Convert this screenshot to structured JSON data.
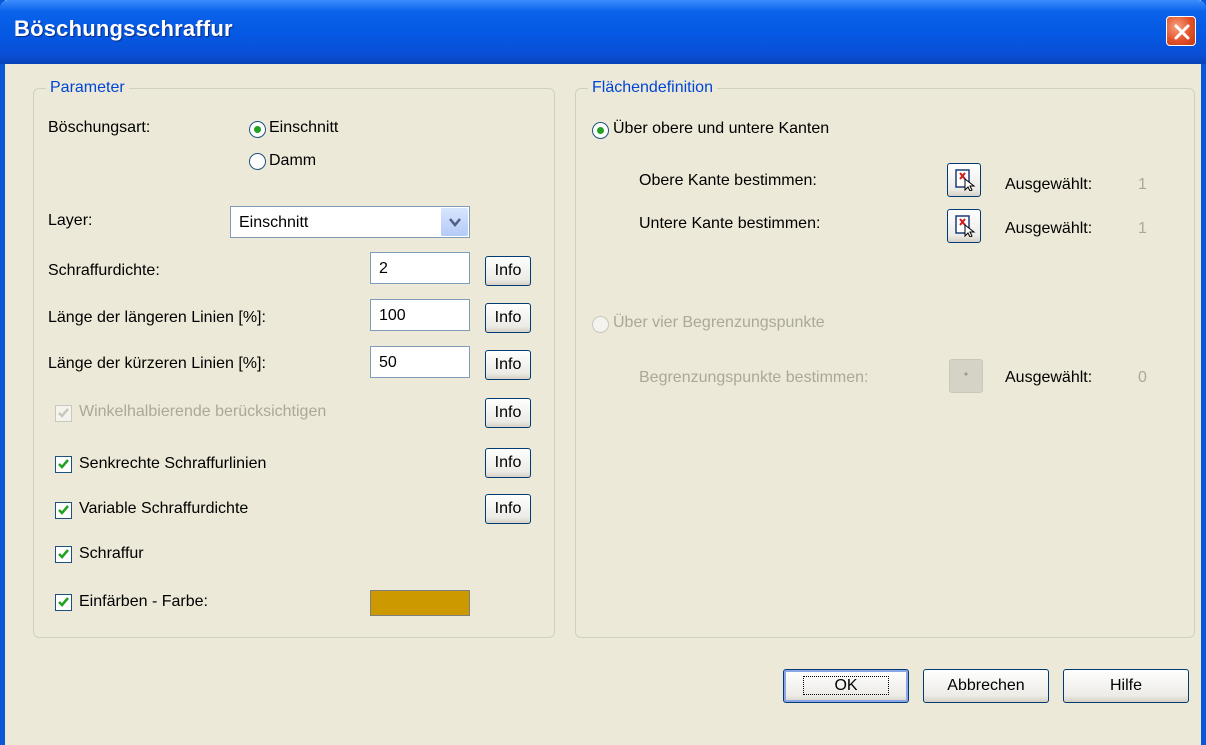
{
  "window": {
    "title": "Böschungsschraffur"
  },
  "parameter": {
    "legend": "Parameter",
    "boeschungsart_label": "Böschungsart:",
    "radio_einschnitt": "Einschnitt",
    "radio_damm": "Damm",
    "layer_label": "Layer:",
    "layer_value": "Einschnitt",
    "dichte_label": "Schraffurdichte:",
    "dichte_value": "2",
    "laengere_label": "Länge der längeren Linien [%]:",
    "laengere_value": "100",
    "kuerzere_label": "Länge der kürzeren Linien [%]:",
    "kuerzere_value": "50",
    "winkel_label": "Winkelhalbierende berücksichtigen",
    "senkrecht_label": "Senkrechte Schraffurlinien",
    "variable_label": "Variable Schraffurdichte",
    "schraffur_label": "Schraffur",
    "einfaerben_label": "Einfärben - Farbe:",
    "einfaerben_color": "#cc9900",
    "info_label": "Info"
  },
  "flaeche": {
    "legend": "Flächendefinition",
    "option_kanten": "Über obere und untere Kanten",
    "obere_label": "Obere Kante bestimmen:",
    "untere_label": "Untere Kante bestimmen:",
    "ausgewaehlt_label": "Ausgewählt:",
    "obere_count": "1",
    "untere_count": "1",
    "option_punkte": "Über vier Begrenzungspunkte",
    "punkte_label": "Begrenzungspunkte bestimmen:",
    "punkte_count": "0"
  },
  "buttons": {
    "ok": "OK",
    "cancel": "Abbrechen",
    "help": "Hilfe"
  },
  "colors": {
    "titlebar": "#0a58d8",
    "dialog_bg": "#ece9d8",
    "group_legend": "#0046d5",
    "check_green": "#21a121"
  }
}
